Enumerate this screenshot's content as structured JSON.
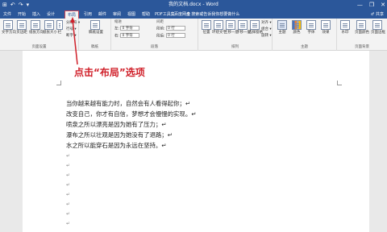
{
  "titlebar": {
    "qat": [
      "⊞",
      "↶",
      "↷",
      "▾"
    ],
    "title": "我的文档.docx - Word",
    "buttons": [
      "—",
      "❐",
      "✕"
    ]
  },
  "tabs": [
    {
      "label": "文件",
      "active": false
    },
    {
      "label": "开始",
      "active": false
    },
    {
      "label": "插入",
      "active": false
    },
    {
      "label": "设计",
      "active": false
    },
    {
      "label": "布局",
      "active": true
    },
    {
      "label": "引用",
      "active": false
    },
    {
      "label": "邮件",
      "active": false
    },
    {
      "label": "审阅",
      "active": false
    },
    {
      "label": "视图",
      "active": false
    },
    {
      "label": "帮助",
      "active": false
    },
    {
      "label": "PDF工具集",
      "active": false
    },
    {
      "label": "百度网盘",
      "active": false
    }
  ],
  "tell_me": "♀ 搜索或告诉我你想要做什么",
  "share": "♂ 共享",
  "ribbon": {
    "page_setup": {
      "label": "页面设置",
      "buttons": [
        "文字方向",
        "页边距",
        "纸张方向",
        "纸张大小",
        "栏"
      ],
      "small": [
        "分隔符 ▾",
        "行号 ▾",
        "断字 ▾"
      ]
    },
    "manuscript": {
      "label": "稿纸",
      "button": "稿纸设置"
    },
    "paragraph": {
      "label": "段落",
      "indent_title": "缩进",
      "left": "左:",
      "left_val": "0 字符",
      "right": "右:",
      "right_val": "0 字符",
      "spacing_title": "间距",
      "before": "段前:",
      "before_val": "0 行",
      "after": "段后:",
      "after_val": "0 行"
    },
    "arrange": {
      "label": "排列",
      "buttons": [
        "位置",
        "环绕文字",
        "上移一层",
        "下移一层",
        "选择窗格"
      ],
      "small": [
        "对齐 ▾",
        "组合 ▾",
        "旋转 ▾"
      ]
    },
    "theme": {
      "label": "主题",
      "buttons": [
        "主题",
        "颜色",
        "字体",
        "效果"
      ]
    },
    "page_bg": {
      "label": "页面背景",
      "buttons": [
        "水印",
        "页面颜色",
        "页面边框"
      ]
    }
  },
  "annotation": "点击“布局”选项",
  "document": {
    "lines": [
      "当你越来越有能力时，自然会有人看得起你；↵",
      "改变自己，你才有自信，梦想才会慢慢的实现。↵",
      "喷泉之所以漂亮是因为她有了压力；↵",
      "瀑布之所以壮观是因为她没有了退路；↵",
      "水之所以能穿石是因为永远在坚持。↵"
    ],
    "para_marks": [
      "↵",
      "↵",
      "↵",
      "↵",
      "↵",
      "↵",
      "↵",
      "↵",
      "↵"
    ]
  }
}
